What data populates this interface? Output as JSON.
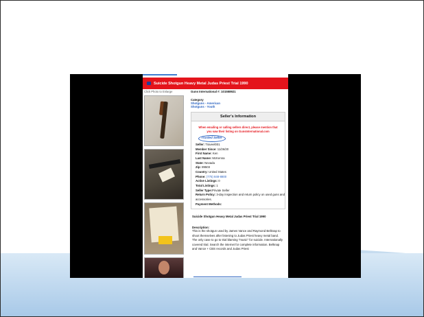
{
  "slide": {
    "accent": "#a8c9e8"
  },
  "listing": {
    "title": "Suicide Shotgun Heavy Metal Judas Priest Trial 1990",
    "photo_hint": "Click Photo to Enlarge",
    "gi_number": "Guns International #: 101558921",
    "category_label": "Category",
    "categories": [
      "Shotguns - American",
      "Shotguns - Youth"
    ],
    "seller_header": "Seller's Information",
    "notice": "When emailing or calling sellers direct, please mention that you saw their listing on GunsInternational.com",
    "seller_logo": "Trusted Seller",
    "details": [
      {
        "k": "Seller:",
        "v": "Traveel001"
      },
      {
        "k": "Member Since:",
        "v": "11/26/20"
      },
      {
        "k": "First Name:",
        "v": "Ken"
      },
      {
        "k": "Last Name:",
        "v": "McKenna"
      },
      {
        "k": "State:",
        "v": "Nevada"
      },
      {
        "k": "Zip:",
        "v": "89503"
      },
      {
        "k": "Country:",
        "v": "United States"
      },
      {
        "k": "Phone:",
        "v": "(775) 848-8800"
      },
      {
        "k": "Active Listings:",
        "v": "0"
      },
      {
        "k": "Total Listings:",
        "v": "1"
      },
      {
        "k": "Seller Type:",
        "v": "Private Seller"
      },
      {
        "k": "Return Policy:",
        "v": "3-day inspection and return policy on used guns and accessories."
      },
      {
        "k": "Payment Methods:",
        "v": ""
      }
    ],
    "listing_title": "Suicide Shotgun Heavy Metal Judas Priest Trial 1990",
    "desc_label": "Description:",
    "description": "This is the shotgun used by James Vance and Raymond Belknap to shoot themselves after listening to Judas Priest heavy metal band. The only case to go to trial blaming \"music\" for suicide. Internationally covered trial. Search the internet for complete information. Belknap and Vance + CBS records and Judas Priest"
  }
}
